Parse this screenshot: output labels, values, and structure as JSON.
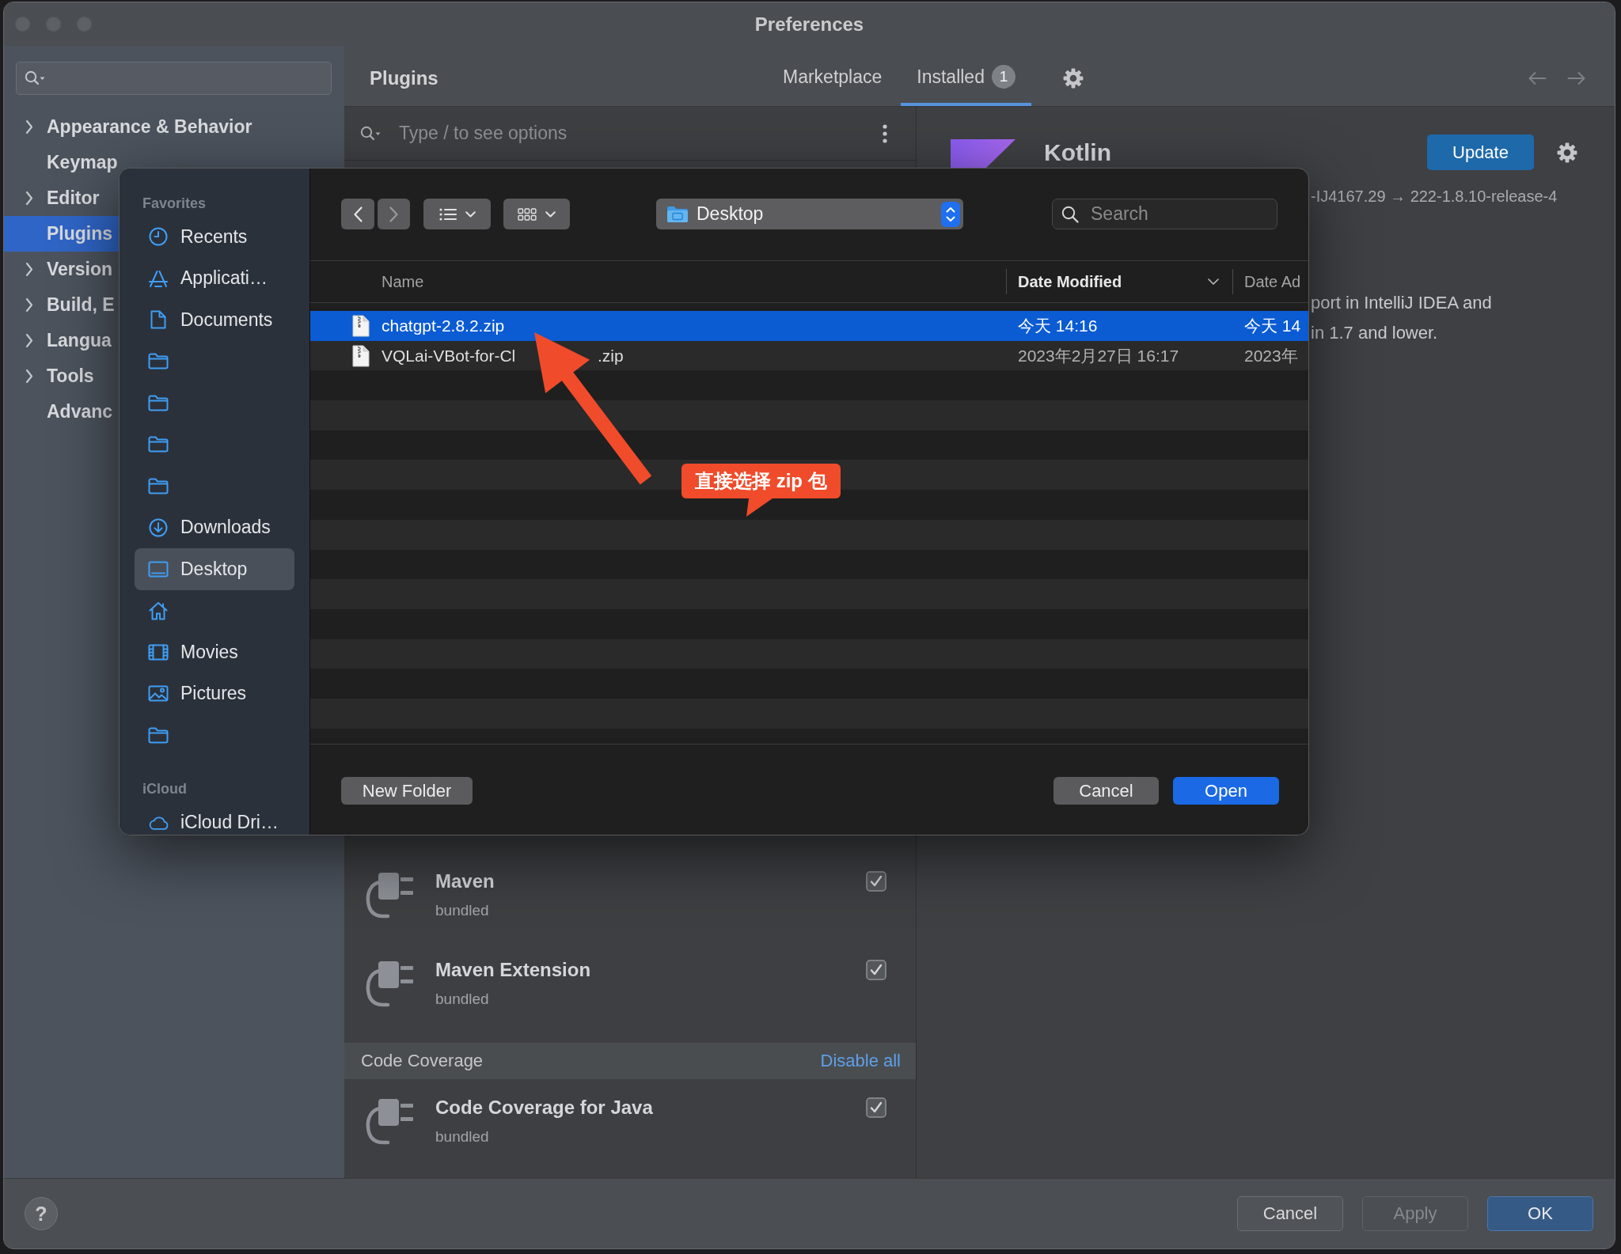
{
  "window": {
    "title": "Preferences"
  },
  "sidebar": {
    "items": [
      {
        "label": "Appearance & Behavior",
        "expandable": true,
        "selected": false
      },
      {
        "label": "Keymap",
        "expandable": false,
        "selected": false
      },
      {
        "label": "Editor",
        "expandable": true,
        "selected": false
      },
      {
        "label": "Plugins",
        "expandable": false,
        "selected": true
      },
      {
        "label": "Version",
        "expandable": true,
        "selected": false
      },
      {
        "label": "Build, E",
        "expandable": true,
        "selected": false
      },
      {
        "label": "Langua",
        "expandable": true,
        "selected": false
      },
      {
        "label": "Tools",
        "expandable": true,
        "selected": false
      },
      {
        "label": "Advanc",
        "expandable": false,
        "selected": false
      }
    ]
  },
  "plugins": {
    "title": "Plugins",
    "tabs": [
      {
        "label": "Marketplace",
        "selected": false
      },
      {
        "label": "Installed",
        "badge": "1",
        "selected": true
      }
    ],
    "search": {
      "placeholder": "Type / to see options"
    },
    "list": [
      {
        "kind": "plugin",
        "name": "Maven",
        "note": "bundled",
        "checked": true
      },
      {
        "kind": "plugin",
        "name": "Maven Extension",
        "note": "bundled",
        "checked": true
      },
      {
        "kind": "group",
        "label": "Code Coverage",
        "action": "Disable all"
      },
      {
        "kind": "plugin",
        "name": "Code Coverage for Java",
        "note": "bundled",
        "checked": true
      }
    ]
  },
  "details": {
    "name": "Kotlin",
    "action": "Update",
    "version": "-IJ4167.29 → 222-1.8.10-release-4",
    "description": [
      "port in IntelliJ IDEA and",
      "in 1.7 and lower."
    ]
  },
  "file_dialog": {
    "navigation": [
      {
        "kind": "back",
        "disabled": false
      },
      {
        "kind": "forward",
        "disabled": true
      }
    ],
    "location": "Desktop",
    "search": {
      "placeholder": "Search"
    },
    "places": [
      {
        "heading": "Favorites",
        "items": [
          {
            "kind": "recents",
            "label": "Recents",
            "selected": false
          },
          {
            "kind": "applications",
            "label": "Applicati…",
            "selected": false
          },
          {
            "kind": "documents",
            "label": "Documents",
            "selected": false
          },
          {
            "kind": "folder",
            "selected": false
          },
          {
            "kind": "folder",
            "selected": false
          },
          {
            "kind": "folder",
            "selected": false
          },
          {
            "kind": "folder",
            "selected": false
          },
          {
            "kind": "downloads",
            "label": "Downloads",
            "selected": false
          },
          {
            "kind": "desktop",
            "label": "Desktop",
            "selected": true
          },
          {
            "kind": "home",
            "selected": false
          },
          {
            "kind": "movies",
            "label": "Movies",
            "selected": false
          },
          {
            "kind": "pictures",
            "label": "Pictures",
            "selected": false
          },
          {
            "kind": "folder",
            "selected": false
          }
        ]
      },
      {
        "heading": "iCloud",
        "items": [
          {
            "kind": "icloud",
            "label": "iCloud Dri…",
            "selected": false
          }
        ]
      }
    ],
    "columns": [
      {
        "label": "Name",
        "sorted": false
      },
      {
        "label": "Date Modified",
        "sorted": true
      },
      {
        "label": "Date Ad",
        "sorted": false
      }
    ],
    "files": [
      {
        "name": "chatgpt-2.8.2.zip",
        "date_modified": "今天 14:16",
        "date_added": "今天 14",
        "selected": true
      },
      {
        "name": "VQLai-VBot-for-Cl",
        "name_end": ".zip",
        "date_modified": "2023年2月27日 16:17",
        "date_added": "2023年",
        "selected": false
      }
    ],
    "new_folder": "New Folder",
    "buttons": [
      {
        "label": "Cancel",
        "default": false
      },
      {
        "label": "Open",
        "default": true
      }
    ]
  },
  "annotation": {
    "label": "直接选择 zip 包"
  },
  "footer": {
    "help": "?",
    "buttons": [
      {
        "label": "Cancel",
        "disabled": false,
        "default": false
      },
      {
        "label": "Apply",
        "disabled": true,
        "default": false
      },
      {
        "label": "OK",
        "disabled": false,
        "default": true
      }
    ]
  }
}
